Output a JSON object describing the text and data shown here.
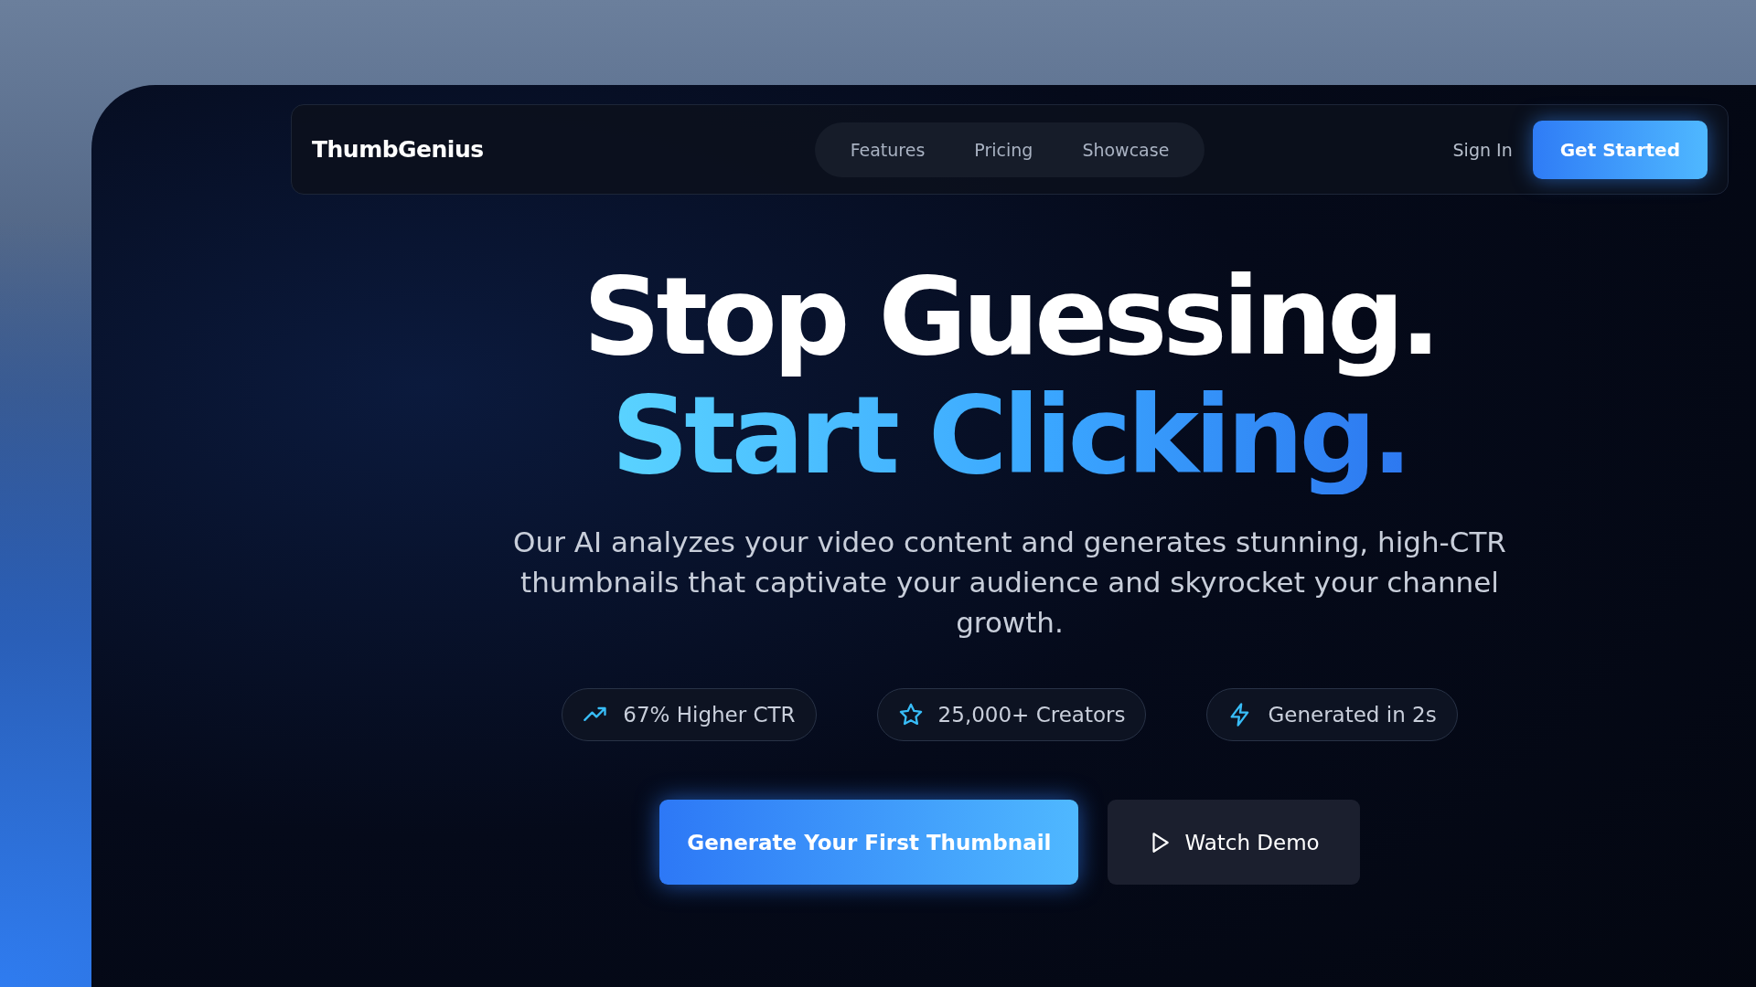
{
  "nav": {
    "logo": "ThumbGenius",
    "links": [
      "Features",
      "Pricing",
      "Showcase"
    ],
    "sign_in": "Sign In",
    "cta": "Get Started"
  },
  "hero": {
    "headline": [
      {
        "text": "Stop Guessing.",
        "kind": "plain"
      },
      {
        "text": "Start Clicking.",
        "kind": "gradient"
      }
    ],
    "subtitle": "Our AI analyzes your video content and generates stunning, high-CTR thumbnails that captivate your audience and skyrocket your channel growth.",
    "badges": [
      "67% Higher CTR",
      "25,000+ Creators",
      "Generated in 2s"
    ],
    "buttons": [
      {
        "label": "Generate Your First Thumbnail",
        "kind": "primary"
      },
      {
        "label": "Watch Demo",
        "kind": "secondary"
      }
    ]
  }
}
